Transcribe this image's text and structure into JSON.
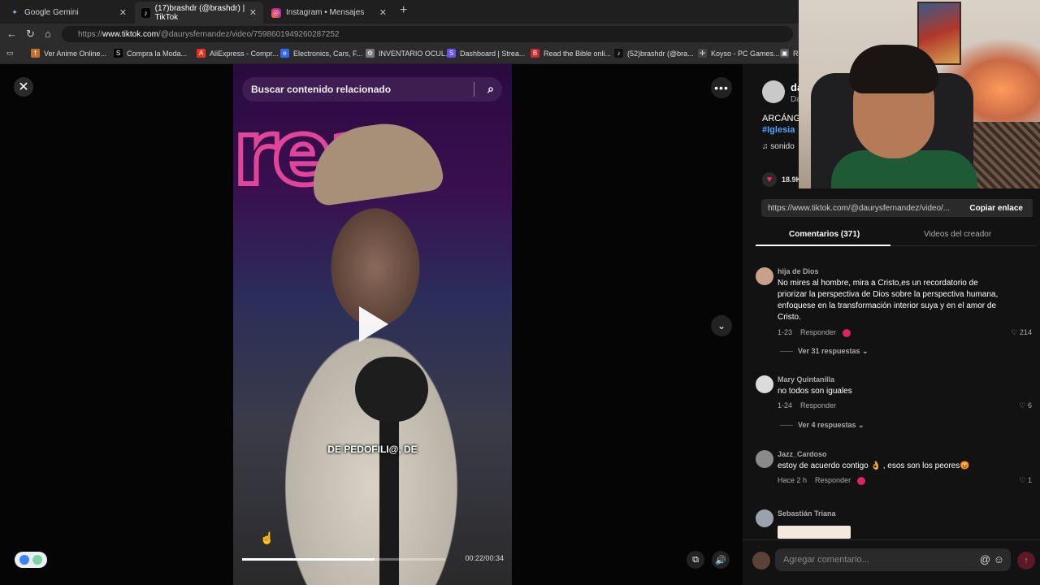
{
  "browser": {
    "tabs": [
      {
        "title": "Google Gemini",
        "icon": "gemini-icon",
        "active": false
      },
      {
        "title": "(17)brashdr (@brashdr) | TikTok",
        "icon": "tiktok-icon",
        "active": true
      },
      {
        "title": "Instagram • Mensajes",
        "icon": "instagram-icon",
        "active": false
      }
    ],
    "new_tab": "+",
    "url": {
      "prefix": "https://",
      "host": "www.tiktok.com",
      "path": "/@daurysfernandez/video/7598601949260287252"
    },
    "bookmarks": [
      {
        "label": "Ver Anime Online...",
        "icon": "anime-icon",
        "color": "#c2712d"
      },
      {
        "label": "Compra la Moda...",
        "icon": "shein-icon",
        "color": "#000000"
      },
      {
        "label": "AliExpress - Compr...",
        "icon": "aliexpress-icon",
        "color": "#e43225"
      },
      {
        "label": "Electronics, Cars, F...",
        "icon": "ebay-icon",
        "color": "#3665f3"
      },
      {
        "label": "INVENTARIO OCUL...",
        "icon": "gear-icon",
        "color": "#777777"
      },
      {
        "label": "Dashboard | Strea...",
        "icon": "streamlabs-icon",
        "color": "#6b4cf5"
      },
      {
        "label": "Read the Bible onli...",
        "icon": "bible-icon",
        "color": "#c92a2a"
      },
      {
        "label": "(52)brashdr (@bra...",
        "icon": "tiktok-icon",
        "color": "#111111"
      },
      {
        "label": "Koyso - PC Games...",
        "icon": "koyso-icon",
        "color": "#444444"
      },
      {
        "label": "RC",
        "icon": "roblox-icon",
        "color": "#cccccc"
      }
    ]
  },
  "video": {
    "search_placeholder": "Buscar contenido relacionado",
    "neon_text": "rea",
    "subtitle": "DE PEDOFILI@, DE",
    "time": "00:22/00:34",
    "progress": 0.65
  },
  "panel": {
    "creator_name": "da",
    "creator_sub": "Da",
    "desc_line1": "ARCÁNG",
    "desc_line2": "#Iglesia",
    "sound": "sonido",
    "likes": "18.9K",
    "share_url": "https://www.tiktok.com/@daurysfernandez/video/...",
    "copy_label": "Copiar enlace",
    "tabs": [
      "Comentarios (371)",
      "Videos del creador"
    ],
    "comments": [
      {
        "user": "hija de Dios",
        "text": "No mires al hombre, mira a Cristo,es un recordatorio de priorizar la perspectiva de Dios sobre la perspectiva humana, enfoquese en la transformación interior suya y en el amor de Cristo.",
        "date": "1-23",
        "reply": "Responder",
        "likes": "214",
        "replies": "Ver 31 respuestas ⌄"
      },
      {
        "user": "Mary Quintanilla",
        "text": "no todos son iguales",
        "date": "1-24",
        "reply": "Responder",
        "likes": "6",
        "replies": "Ver 4 respuestas ⌄"
      },
      {
        "user": "Jazz_Cardoso",
        "text": "estoy de acuerdo contigo 👌 , esos son los peores😡",
        "date": "Hace 2 h",
        "reply": "Responder",
        "likes": "1",
        "replies": ""
      },
      {
        "user": "Sebastián Triana",
        "text": "",
        "date": "",
        "reply": "",
        "likes": "",
        "replies": ""
      }
    ],
    "comment_placeholder": "Agregar comentario..."
  },
  "colors": {
    "accent": "#fe2c55",
    "link": "#4fa3ff"
  }
}
